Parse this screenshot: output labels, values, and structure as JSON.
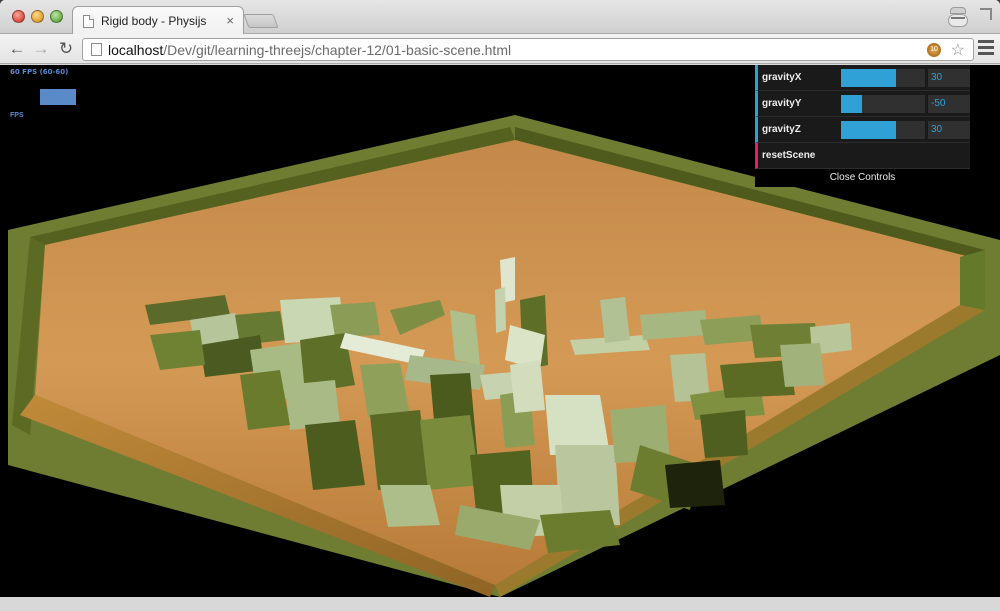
{
  "browser": {
    "tab_title": "Rigid body - Physijs",
    "tab_close": "×",
    "url_host": "localhost",
    "url_path": "/Dev/git/learning-threejs/chapter-12/01-basic-scene.html",
    "extension_badge": "10",
    "back_glyph": "←",
    "forward_glyph": "→",
    "reload_glyph": "↻",
    "star_glyph": "☆"
  },
  "stats": {
    "fps_label": "60 FPS (60-60)",
    "fps_bottom": "FPS"
  },
  "gui": {
    "controls": [
      {
        "label": "gravityX",
        "value": "30",
        "fraction": 0.65
      },
      {
        "label": "gravityY",
        "value": "-50",
        "fraction": 0.25
      },
      {
        "label": "gravityZ",
        "value": "30",
        "fraction": 0.65
      }
    ],
    "reset_label": "resetScene",
    "close_label": "Close Controls"
  },
  "colors": {
    "gui_accent": "#2fa1d6",
    "gui_function": "#e61d5f",
    "floor": "#c98a3f",
    "walls": "#7a8a3a"
  }
}
